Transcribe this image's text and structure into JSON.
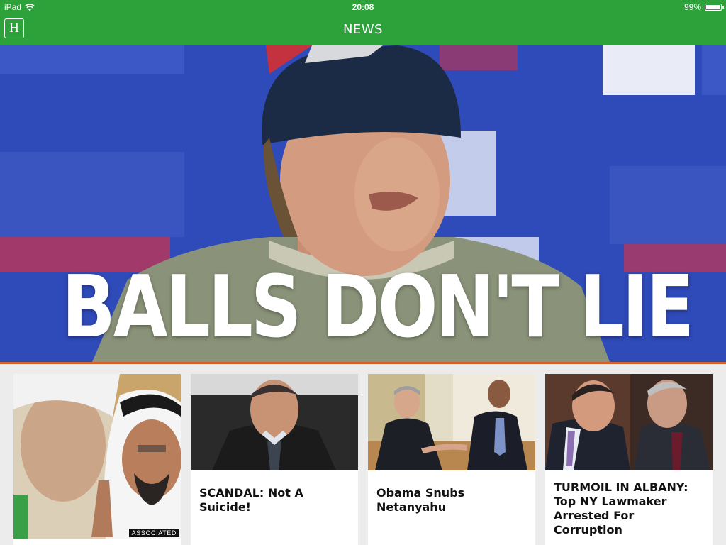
{
  "status_bar": {
    "device": "iPad",
    "time": "20:08",
    "battery": "99%",
    "battery_level": 0.99
  },
  "nav": {
    "logo_letter": "H",
    "title": "NEWS"
  },
  "hero": {
    "headline": "BALLS DON'T LIE"
  },
  "cards": [
    {
      "title": "",
      "credit": "ASSOCIATED"
    },
    {
      "title": "SCANDAL: Not A Suicide!"
    },
    {
      "title": "Obama Snubs Netanyahu"
    },
    {
      "title": "TURMOIL IN ALBANY: Top NY Lawmaker Arrested For Corruption"
    }
  ],
  "colors": {
    "nav_green": "#2da23a",
    "hero_blue": "#2e4bbd",
    "accent_rule": "#d9602a"
  }
}
